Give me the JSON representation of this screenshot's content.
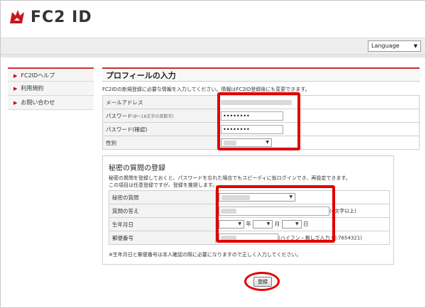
{
  "header": {
    "logo_text": "FC2 ID"
  },
  "topbar": {
    "language_label": "Language"
  },
  "sidebar": {
    "items": [
      {
        "label": "FC2IDヘルプ"
      },
      {
        "label": "利用規約"
      },
      {
        "label": "お問い合わせ"
      }
    ]
  },
  "profile": {
    "title": "プロフィールの入力",
    "lead": "FC2IDの新規登録に必要な情報を入力してください。情報はFC2ID登録後にも変更できます。",
    "rows": {
      "email": {
        "label": "メールアドレス"
      },
      "password": {
        "label": "パスワード",
        "hint": "(8〜16文字の英数字)",
        "value": "••••••••"
      },
      "password_confirm": {
        "label": "パスワード(確認)",
        "value": "••••••••"
      },
      "gender": {
        "label": "性別"
      }
    }
  },
  "secret": {
    "title": "秘密の質問の登録",
    "text_1": "秘密の質問を登録しておくと、パスワードを忘れた場合でもスピーディに仮ログインでき、再設定できます。",
    "text_2": "この項目は任意登録ですが、登録を推奨します。",
    "rows": {
      "question": {
        "label": "秘密の質問"
      },
      "answer": {
        "label": "質問の答え",
        "suffix": "(4文字以上)"
      },
      "birthday": {
        "label": "生年月日",
        "year_unit": "年",
        "month_unit": "月",
        "day_unit": "日"
      },
      "postal": {
        "label": "郵便番号",
        "suffix": "(ハイフン・無しで入力 例:7654321)"
      }
    },
    "note": "※生年月日と郵便番号は本人確認の際に必要になりますので正しく入力してください。"
  },
  "actions": {
    "submit_label": "登録"
  },
  "colors": {
    "accent": "#c03030",
    "highlight": "#e00000"
  }
}
